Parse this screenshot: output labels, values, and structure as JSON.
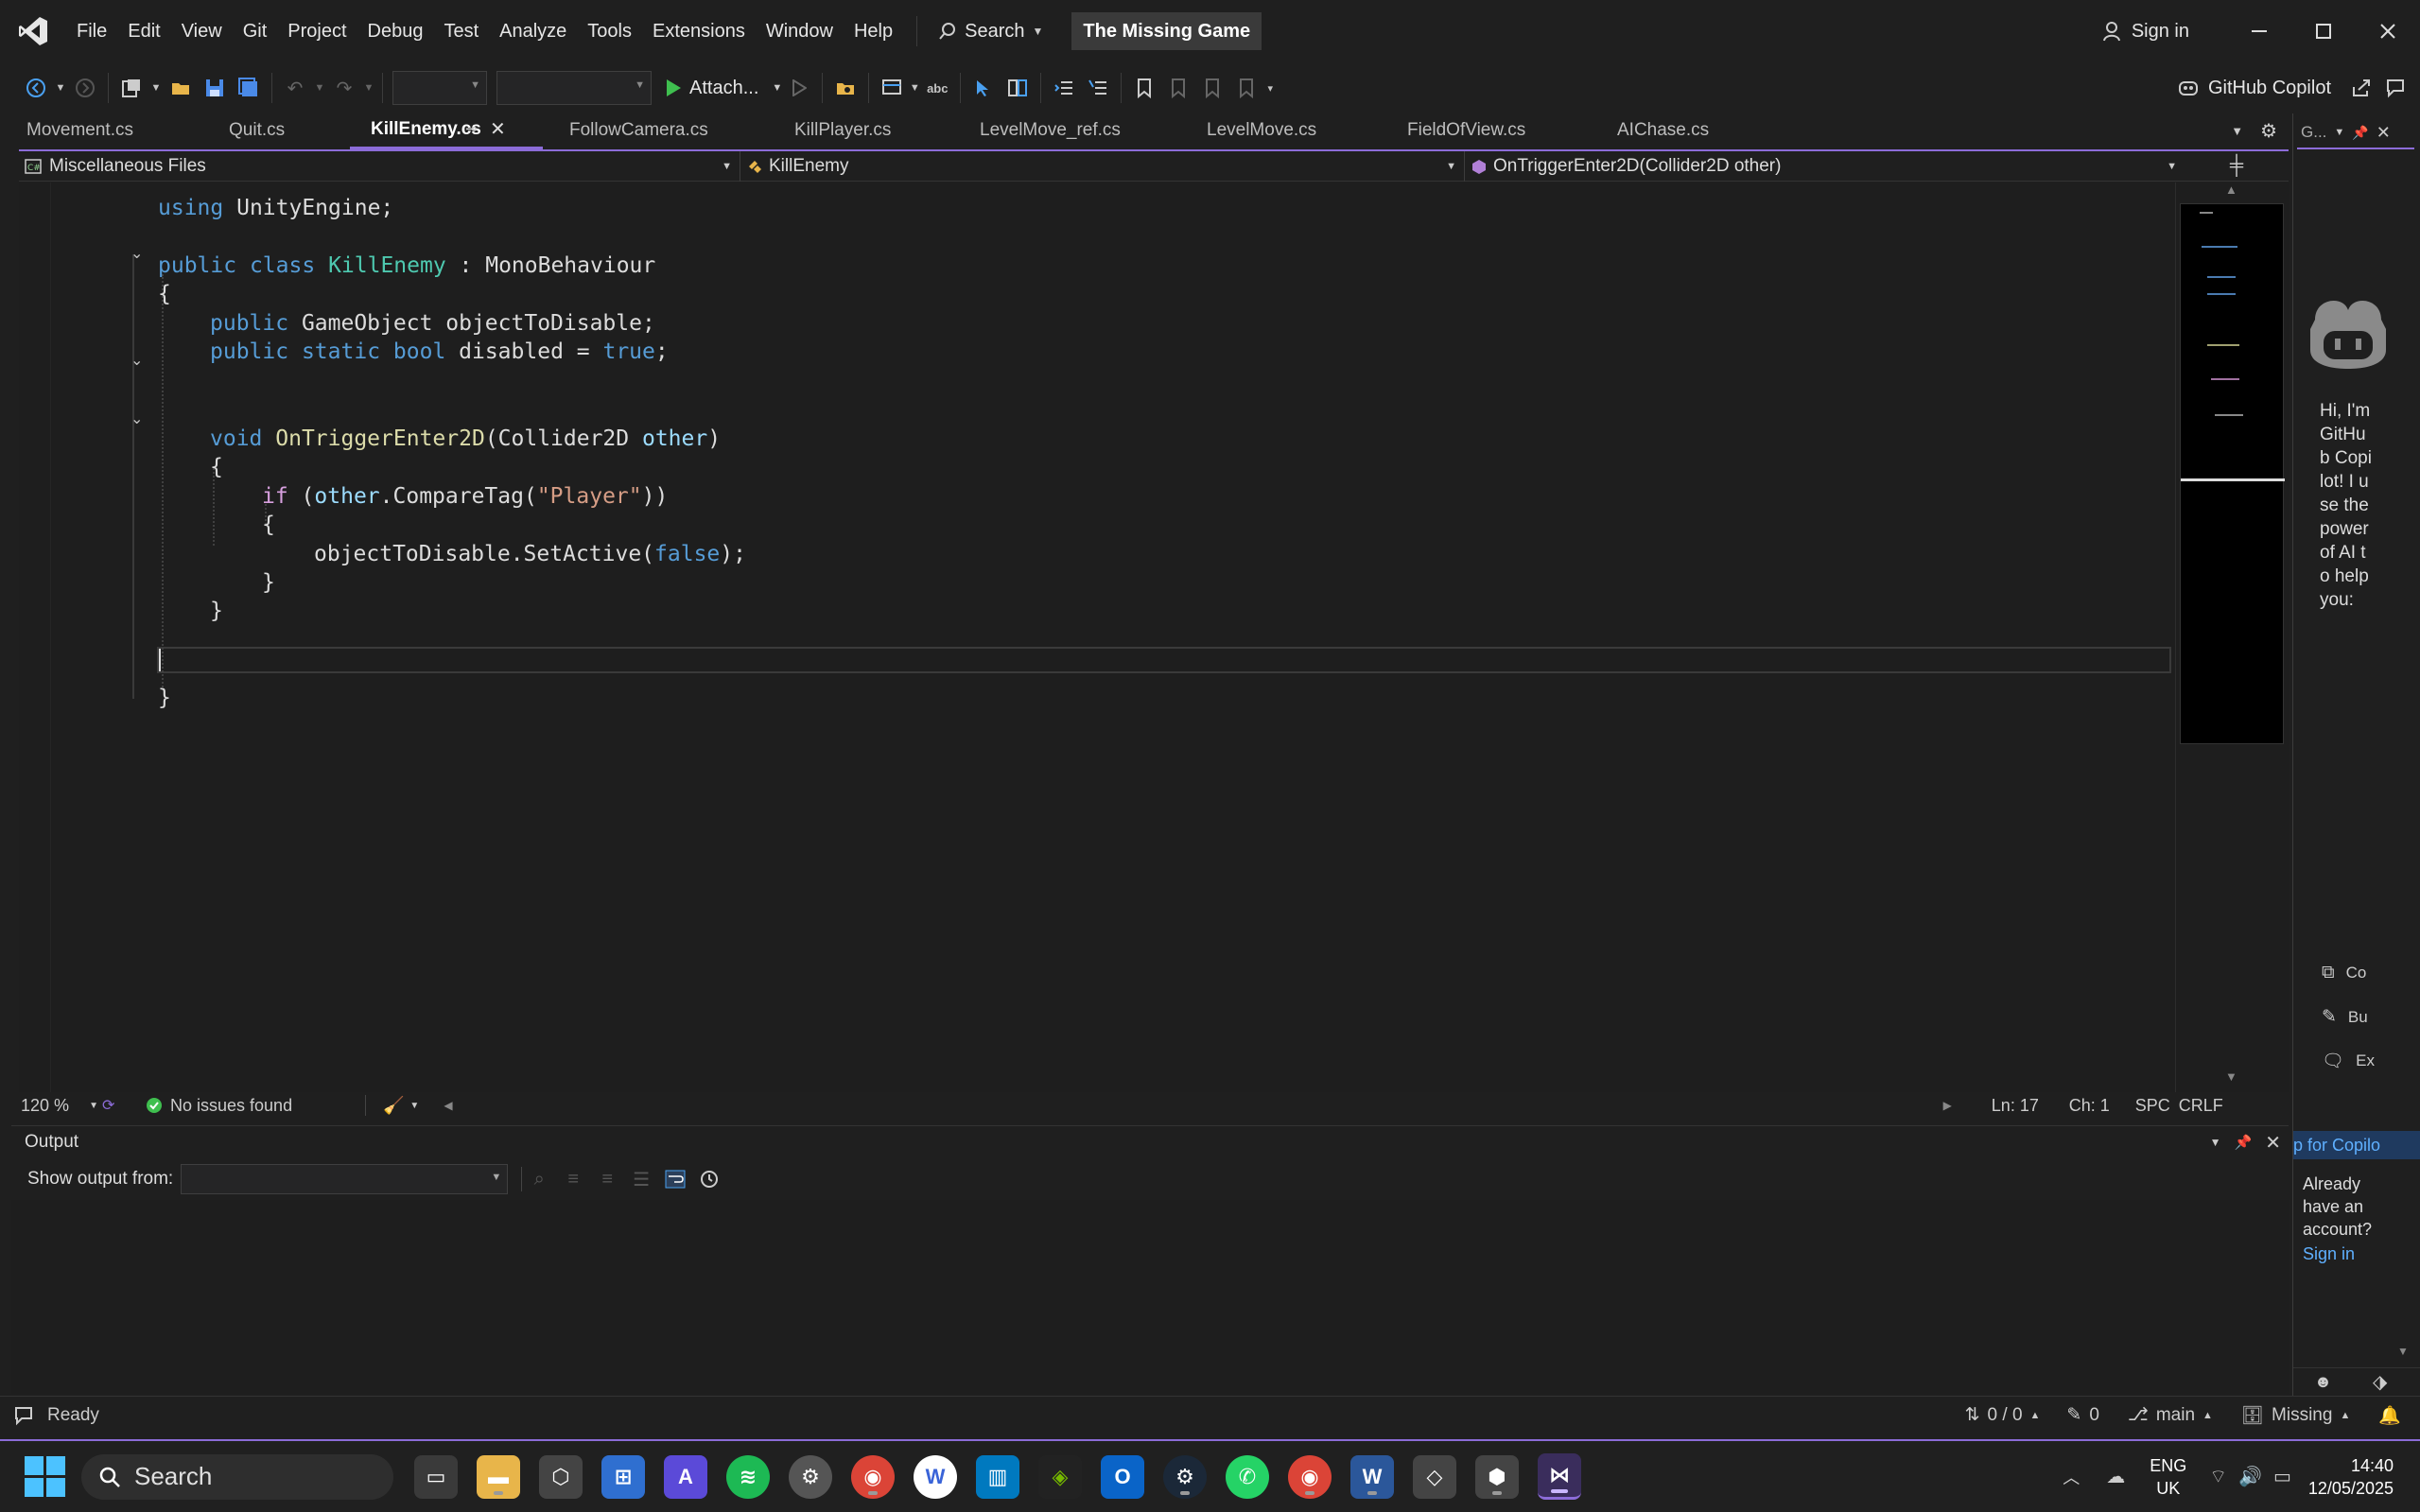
{
  "titlebar": {
    "menus": [
      "File",
      "Edit",
      "View",
      "Git",
      "Project",
      "Debug",
      "Test",
      "Analyze",
      "Tools",
      "Extensions",
      "Window",
      "Help"
    ],
    "search_label": "Search",
    "solution_name": "The Missing Game",
    "sign_in": "Sign in"
  },
  "toolbar": {
    "attach_label": "Attach...",
    "copilot_label": "GitHub Copilot"
  },
  "tabs": [
    {
      "label": "Movement.cs",
      "active": false
    },
    {
      "label": "Quit.cs",
      "active": false
    },
    {
      "label": "KillEnemy.cs",
      "active": true
    },
    {
      "label": "FollowCamera.cs",
      "active": false
    },
    {
      "label": "KillPlayer.cs",
      "active": false
    },
    {
      "label": "LevelMove_ref.cs",
      "active": false
    },
    {
      "label": "LevelMove.cs",
      "active": false
    },
    {
      "label": "FieldOfView.cs",
      "active": false
    },
    {
      "label": "AIChase.cs",
      "active": false
    }
  ],
  "navbar": {
    "project": "Miscellaneous Files",
    "class": "KillEnemy",
    "member": "OnTriggerEnter2D(Collider2D other)"
  },
  "code": {
    "l1": [
      "using",
      " UnityEngine;"
    ],
    "l3": [
      "public",
      " ",
      "class",
      " ",
      "KillEnemy",
      " : MonoBehaviour"
    ],
    "l4": "{",
    "l5": [
      "public",
      " GameObject objectToDisable;"
    ],
    "l6": [
      "public",
      " ",
      "static",
      " ",
      "bool",
      " disabled = ",
      "true",
      ";"
    ],
    "l9": [
      "void",
      " ",
      "OnTriggerEnter2D",
      "(Collider2D ",
      "other",
      ")"
    ],
    "l10": "{",
    "l11": [
      "if",
      " (",
      "other",
      ".CompareTag(",
      "\"Player\"",
      "))"
    ],
    "l12": "{",
    "l13": [
      "objectToDisable.SetActive(",
      "false",
      ");"
    ],
    "l14": "}",
    "l15": "}",
    "l18": "}"
  },
  "editor_status": {
    "zoom": "120 %",
    "issues": "No issues found",
    "line": "Ln: 17",
    "col": "Ch: 1",
    "spc": "SPC",
    "crlf": "CRLF"
  },
  "output": {
    "title": "Output",
    "show_from_label": "Show output from:"
  },
  "copilot": {
    "title": "G...",
    "greeting": "Hi, I'm GitHub Copilot! I use the power of AI to help you:",
    "items": [
      "Co",
      "Bu",
      "Ex"
    ],
    "signup": "p for Copilo",
    "account_q": "Already have an account?",
    "signin": "Sign in"
  },
  "statusbar": {
    "ready": "Ready",
    "changes": "0 / 0",
    "pencil_count": "0",
    "branch": "main",
    "repo": "Missing"
  },
  "taskbar": {
    "search_label": "Search",
    "lang": "ENG",
    "region": "UK",
    "time": "14:40",
    "date": "12/05/2025"
  },
  "colors": {
    "accent": "#8c6cd8",
    "keyword": "#569cd6",
    "type": "#4ec9b0",
    "method": "#dcdcaa",
    "string": "#d69d85",
    "control": "#d8a0df"
  }
}
